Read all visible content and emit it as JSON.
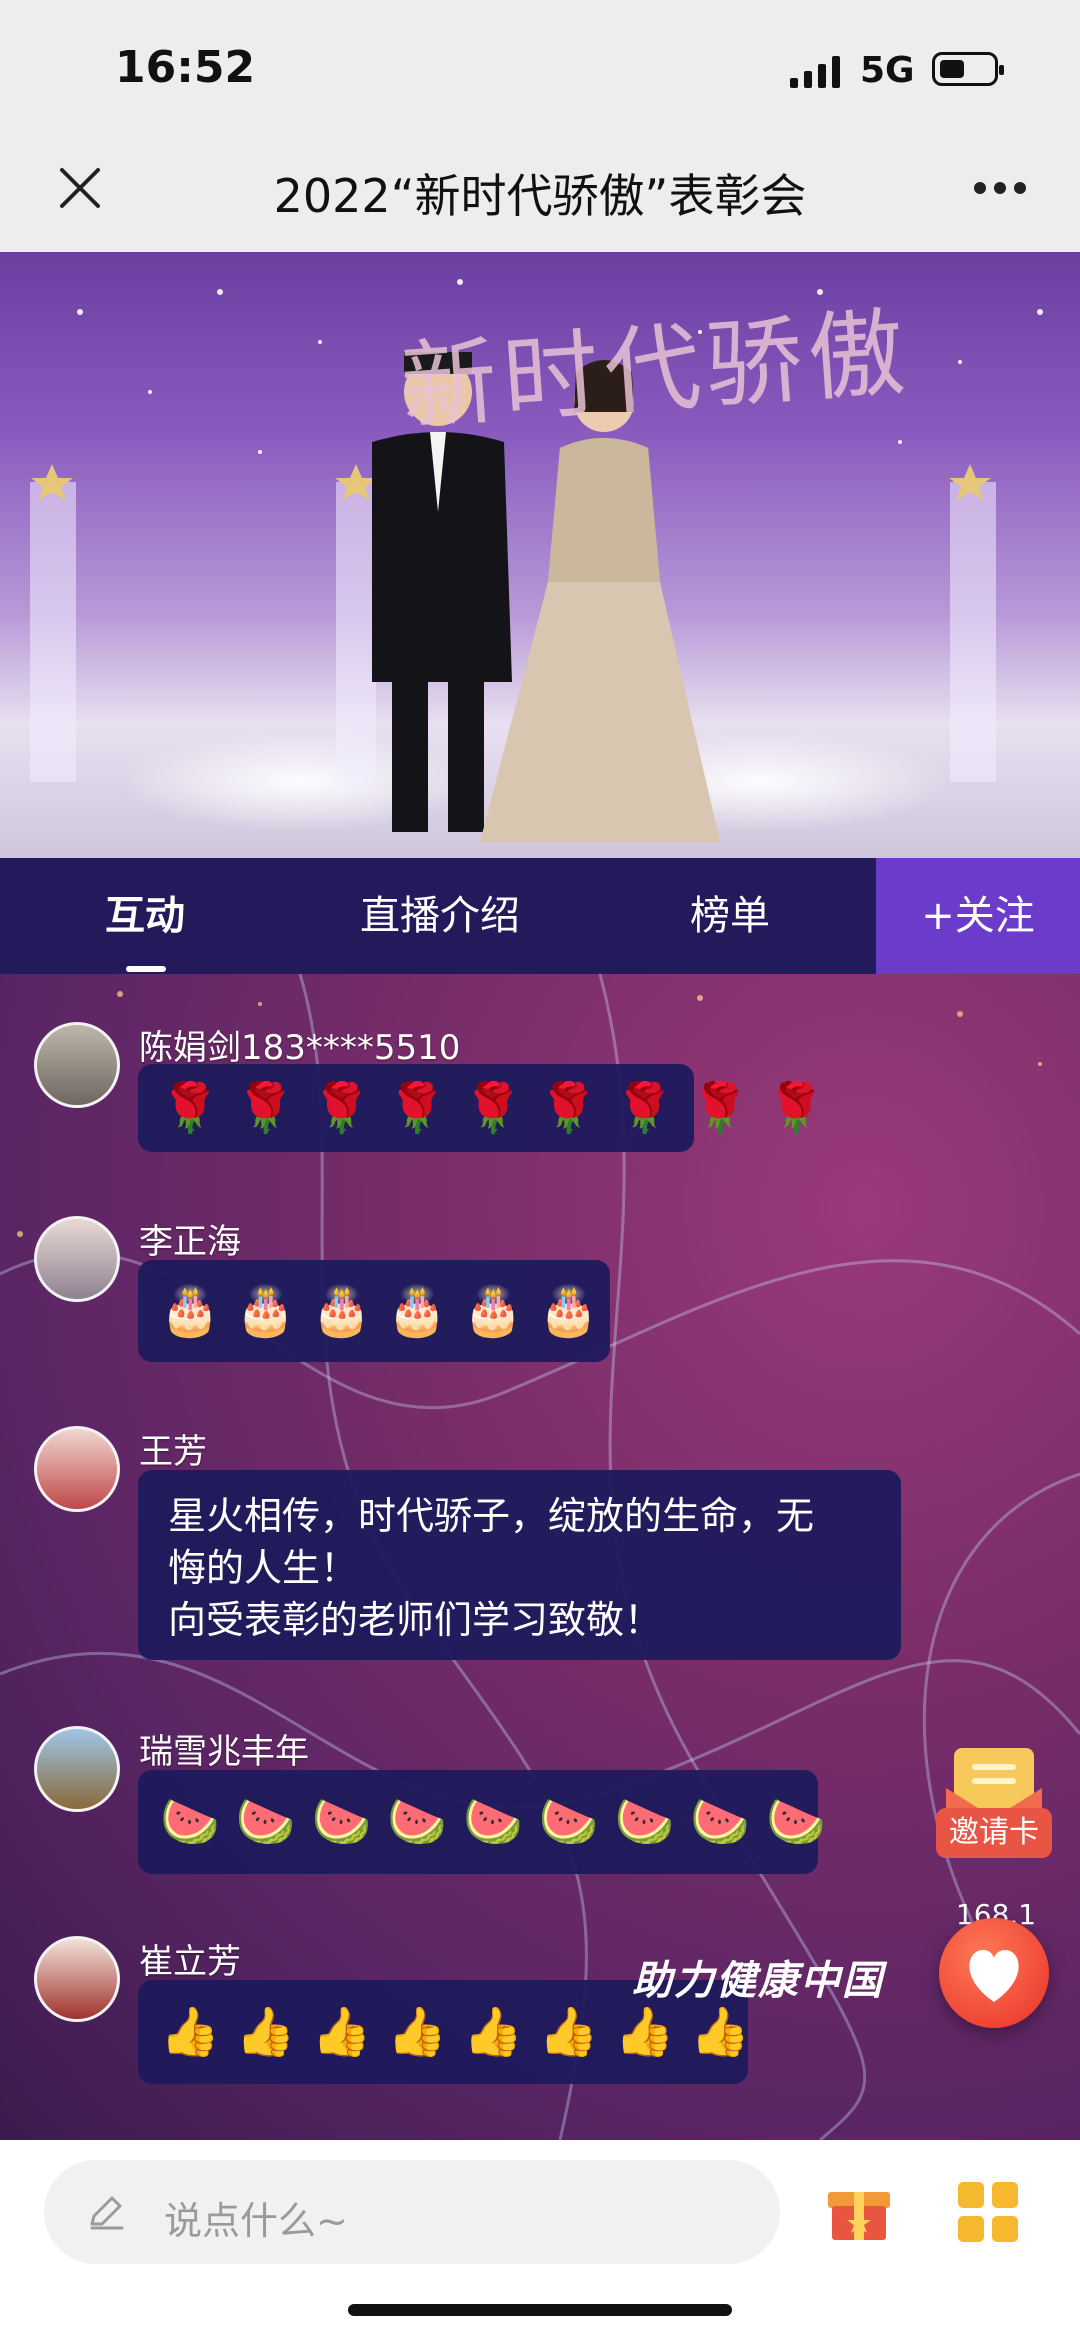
{
  "status": {
    "time": "16:52",
    "network": "5G"
  },
  "header": {
    "title": "2022“新时代骄傲”表彰会",
    "close_icon": "close-icon",
    "more_icon": "more-icon"
  },
  "video": {
    "backdrop_text": "新时代骄傲"
  },
  "tabs": [
    {
      "label": "互动",
      "active": true
    },
    {
      "label": "直播介绍",
      "active": false
    },
    {
      "label": "榜单",
      "active": false
    }
  ],
  "follow_label": "+关注",
  "messages": [
    {
      "name": "陈娟剑183****5510",
      "emojis": [
        "🌹",
        "🌹",
        "🌹",
        "🌹",
        "🌹",
        "🌹",
        "🌹",
        "🌹",
        "🌹"
      ]
    },
    {
      "name": "李正海",
      "emojis": [
        "🎂",
        "🎂",
        "🎂",
        "🎂",
        "🎂",
        "🎂"
      ]
    },
    {
      "name": "王芳",
      "text_lines": [
        "星火相传，时代骄子，绽放的生命，无",
        "悔的人生！",
        "向受表彰的老师们学习致敬！"
      ]
    },
    {
      "name": "瑞雪兆丰年",
      "emojis": [
        "🍉",
        "🍉",
        "🍉",
        "🍉",
        "🍉",
        "🍉",
        "🍉",
        "🍉",
        "🍉"
      ]
    },
    {
      "name": "崔立芳",
      "emojis": [
        "👍",
        "👍",
        "👍",
        "👍",
        "👍",
        "👍",
        "👍",
        "👍"
      ]
    }
  ],
  "invite_label": "邀请卡",
  "like_count": "168.1万",
  "slogan": "助力健康中国",
  "input": {
    "placeholder": "说点什么~"
  },
  "colors": {
    "tab_bar": "#231a5c",
    "follow": "#6b3cc9",
    "bubble": "#1e1a5c",
    "like": "#e8302a"
  }
}
